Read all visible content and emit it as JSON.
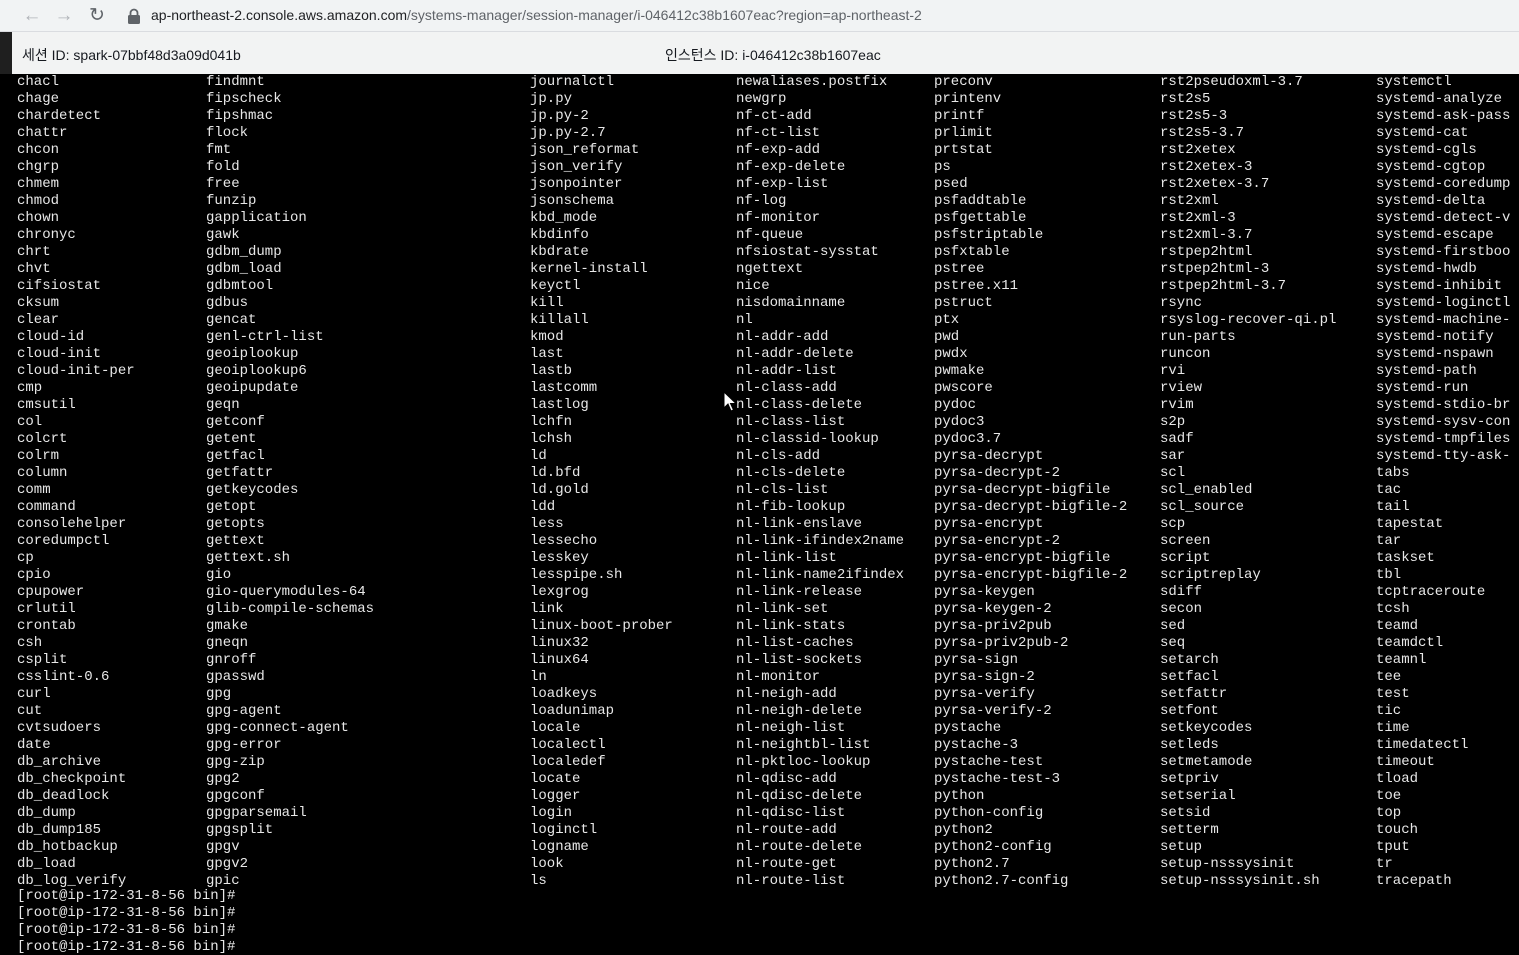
{
  "browser": {
    "url_host": "ap-northeast-2.console.aws.amazon.com",
    "url_path": "/systems-manager/session-manager/i-046412c38b1607eac?region=ap-northeast-2",
    "icons": [
      "back-arrow-icon",
      "forward-arrow-icon",
      "reload-icon",
      "lock-icon"
    ]
  },
  "session": {
    "session_id": "세션 ID: spark-07bbf48d3a09d041b",
    "instance_id": "인스턴스 ID: i-046412c38b1607eac"
  },
  "terminal": {
    "columns": [
      [
        "chacl",
        "chage",
        "chardetect",
        "chattr",
        "chcon",
        "chgrp",
        "chmem",
        "chmod",
        "chown",
        "chronyc",
        "chrt",
        "chvt",
        "cifsiostat",
        "cksum",
        "clear",
        "cloud-id",
        "cloud-init",
        "cloud-init-per",
        "cmp",
        "cmsutil",
        "col",
        "colcrt",
        "colrm",
        "column",
        "comm",
        "command",
        "consolehelper",
        "coredumpctl",
        "cp",
        "cpio",
        "cpupower",
        "crlutil",
        "crontab",
        "csh",
        "csplit",
        "csslint-0.6",
        "curl",
        "cut",
        "cvtsudoers",
        "date",
        "db_archive",
        "db_checkpoint",
        "db_deadlock",
        "db_dump",
        "db_dump185",
        "db_hotbackup",
        "db_load",
        "db_log_verify"
      ],
      [
        "findmnt",
        "fipscheck",
        "fipshmac",
        "flock",
        "fmt",
        "fold",
        "free",
        "funzip",
        "gapplication",
        "gawk",
        "gdbm_dump",
        "gdbm_load",
        "gdbmtool",
        "gdbus",
        "gencat",
        "genl-ctrl-list",
        "geoiplookup",
        "geoiplookup6",
        "geoipupdate",
        "geqn",
        "getconf",
        "getent",
        "getfacl",
        "getfattr",
        "getkeycodes",
        "getopt",
        "getopts",
        "gettext",
        "gettext.sh",
        "gio",
        "gio-querymodules-64",
        "glib-compile-schemas",
        "gmake",
        "gneqn",
        "gnroff",
        "gpasswd",
        "gpg",
        "gpg-agent",
        "gpg-connect-agent",
        "gpg-error",
        "gpg-zip",
        "gpg2",
        "gpgconf",
        "gpgparsemail",
        "gpgsplit",
        "gpgv",
        "gpgv2",
        "gpic"
      ],
      [
        "journalctl",
        "jp.py",
        "jp.py-2",
        "jp.py-2.7",
        "json_reformat",
        "json_verify",
        "jsonpointer",
        "jsonschema",
        "kbd_mode",
        "kbdinfo",
        "kbdrate",
        "kernel-install",
        "keyctl",
        "kill",
        "killall",
        "kmod",
        "last",
        "lastb",
        "lastcomm",
        "lastlog",
        "lchfn",
        "lchsh",
        "ld",
        "ld.bfd",
        "ld.gold",
        "ldd",
        "less",
        "lessecho",
        "lesskey",
        "lesspipe.sh",
        "lexgrog",
        "link",
        "linux-boot-prober",
        "linux32",
        "linux64",
        "ln",
        "loadkeys",
        "loadunimap",
        "locale",
        "localectl",
        "localedef",
        "locate",
        "logger",
        "login",
        "loginctl",
        "logname",
        "look",
        "ls"
      ],
      [
        "newaliases.postfix",
        "newgrp",
        "nf-ct-add",
        "nf-ct-list",
        "nf-exp-add",
        "nf-exp-delete",
        "nf-exp-list",
        "nf-log",
        "nf-monitor",
        "nf-queue",
        "nfsiostat-sysstat",
        "ngettext",
        "nice",
        "nisdomainname",
        "nl",
        "nl-addr-add",
        "nl-addr-delete",
        "nl-addr-list",
        "nl-class-add",
        "nl-class-delete",
        "nl-class-list",
        "nl-classid-lookup",
        "nl-cls-add",
        "nl-cls-delete",
        "nl-cls-list",
        "nl-fib-lookup",
        "nl-link-enslave",
        "nl-link-ifindex2name",
        "nl-link-list",
        "nl-link-name2ifindex",
        "nl-link-release",
        "nl-link-set",
        "nl-link-stats",
        "nl-list-caches",
        "nl-list-sockets",
        "nl-monitor",
        "nl-neigh-add",
        "nl-neigh-delete",
        "nl-neigh-list",
        "nl-neightbl-list",
        "nl-pktloc-lookup",
        "nl-qdisc-add",
        "nl-qdisc-delete",
        "nl-qdisc-list",
        "nl-route-add",
        "nl-route-delete",
        "nl-route-get",
        "nl-route-list"
      ],
      [
        "preconv",
        "printenv",
        "printf",
        "prlimit",
        "prtstat",
        "ps",
        "psed",
        "psfaddtable",
        "psfgettable",
        "psfstriptable",
        "psfxtable",
        "pstree",
        "pstree.x11",
        "pstruct",
        "ptx",
        "pwd",
        "pwdx",
        "pwmake",
        "pwscore",
        "pydoc",
        "pydoc3",
        "pydoc3.7",
        "pyrsa-decrypt",
        "pyrsa-decrypt-2",
        "pyrsa-decrypt-bigfile",
        "pyrsa-decrypt-bigfile-2",
        "pyrsa-encrypt",
        "pyrsa-encrypt-2",
        "pyrsa-encrypt-bigfile",
        "pyrsa-encrypt-bigfile-2",
        "pyrsa-keygen",
        "pyrsa-keygen-2",
        "pyrsa-priv2pub",
        "pyrsa-priv2pub-2",
        "pyrsa-sign",
        "pyrsa-sign-2",
        "pyrsa-verify",
        "pyrsa-verify-2",
        "pystache",
        "pystache-3",
        "pystache-test",
        "pystache-test-3",
        "python",
        "python-config",
        "python2",
        "python2-config",
        "python2.7",
        "python2.7-config"
      ],
      [
        "rst2pseudoxml-3.7",
        "rst2s5",
        "rst2s5-3",
        "rst2s5-3.7",
        "rst2xetex",
        "rst2xetex-3",
        "rst2xetex-3.7",
        "rst2xml",
        "rst2xml-3",
        "rst2xml-3.7",
        "rstpep2html",
        "rstpep2html-3",
        "rstpep2html-3.7",
        "rsync",
        "rsyslog-recover-qi.pl",
        "run-parts",
        "runcon",
        "rvi",
        "rview",
        "rvim",
        "s2p",
        "sadf",
        "sar",
        "scl",
        "scl_enabled",
        "scl_source",
        "scp",
        "screen",
        "script",
        "scriptreplay",
        "sdiff",
        "secon",
        "sed",
        "seq",
        "setarch",
        "setfacl",
        "setfattr",
        "setfont",
        "setkeycodes",
        "setleds",
        "setmetamode",
        "setpriv",
        "setserial",
        "setsid",
        "setterm",
        "setup",
        "setup-nsssysinit",
        "setup-nsssysinit.sh"
      ],
      [
        "systemctl",
        "systemd-analyze",
        "systemd-ask-pass",
        "systemd-cat",
        "systemd-cgls",
        "systemd-cgtop",
        "systemd-coredump",
        "systemd-delta",
        "systemd-detect-v",
        "systemd-escape",
        "systemd-firstboo",
        "systemd-hwdb",
        "systemd-inhibit",
        "systemd-loginctl",
        "systemd-machine-",
        "systemd-notify",
        "systemd-nspawn",
        "systemd-path",
        "systemd-run",
        "systemd-stdio-br",
        "systemd-sysv-con",
        "systemd-tmpfiles",
        "systemd-tty-ask-",
        "tabs",
        "tac",
        "tail",
        "tapestat",
        "tar",
        "taskset",
        "tbl",
        "tcptraceroute",
        "tcsh",
        "teamd",
        "teamdctl",
        "teamnl",
        "tee",
        "test",
        "tic",
        "time",
        "timedatectl",
        "timeout",
        "tload",
        "toe",
        "top",
        "touch",
        "tput",
        "tr",
        "tracepath"
      ]
    ],
    "prompts": [
      "[root@ip-172-31-8-56 bin]#",
      "[root@ip-172-31-8-56 bin]#",
      "[root@ip-172-31-8-56 bin]#",
      "[root@ip-172-31-8-56 bin]#"
    ]
  }
}
